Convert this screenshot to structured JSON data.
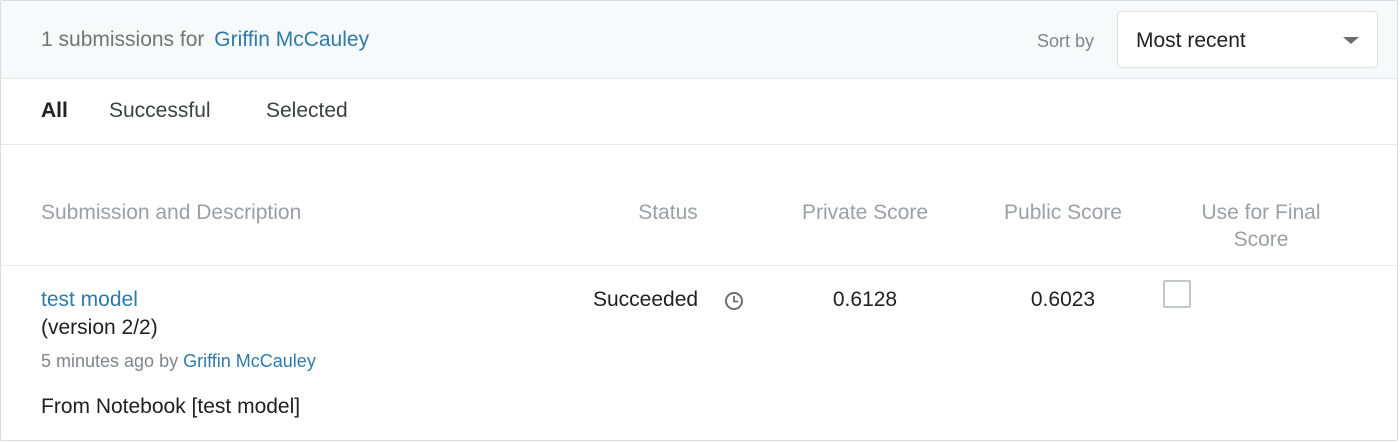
{
  "header": {
    "count_text": "1 submissions for",
    "user_name": "Griffin McCauley",
    "sort_label": "Sort by",
    "sort_value": "Most recent"
  },
  "tabs": [
    {
      "label": "All",
      "active": true
    },
    {
      "label": "Successful",
      "active": false
    },
    {
      "label": "Selected",
      "active": false
    }
  ],
  "columns": {
    "submission": "Submission and Description",
    "status": "Status",
    "private_score": "Private Score",
    "public_score": "Public Score",
    "final_line1": "Use for Final",
    "final_line2": "Score"
  },
  "rows": [
    {
      "title": "test model",
      "version": "(version 2/2)",
      "time_by": "5 minutes ago by",
      "author": "Griffin McCauley",
      "description": "From Notebook [test model]",
      "status": "Succeeded",
      "status_icon": "clock-icon",
      "private_score": "0.6128",
      "public_score": "0.6023",
      "use_for_final": false
    }
  ],
  "colors": {
    "link": "#2e7bab",
    "header_bg": "#f8f9fa",
    "muted_text": "#9aa0a6"
  }
}
